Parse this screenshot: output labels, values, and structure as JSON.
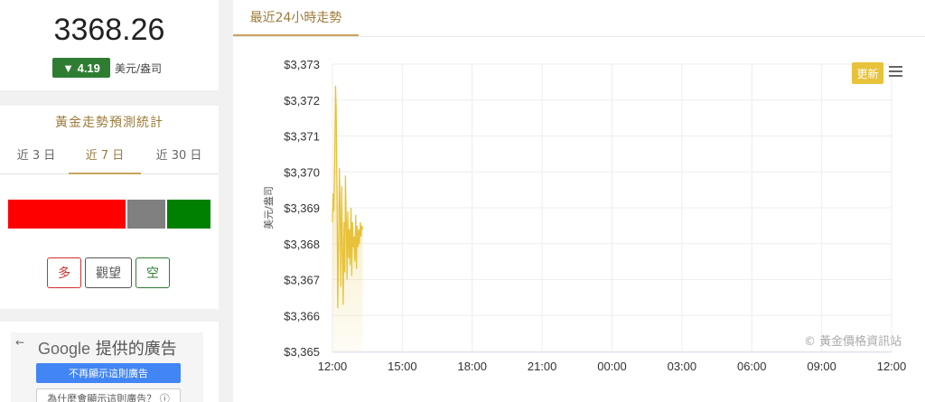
{
  "price_card": {
    "price": "3368.26",
    "change": "▼ 4.19",
    "unit": "美元/盎司"
  },
  "forecast": {
    "title": "黃金走勢預測統計",
    "tabs": [
      {
        "label": "近 3 日",
        "active": false
      },
      {
        "label": "近 7 日",
        "active": true
      },
      {
        "label": "近 30 日",
        "active": false
      }
    ],
    "bar": [
      {
        "name": "多",
        "fraction": 0.58,
        "color": "#ff0000"
      },
      {
        "name": "觀望",
        "fraction": 0.195,
        "color": "#808080"
      },
      {
        "name": "空",
        "fraction": 0.225,
        "color": "#008000"
      }
    ],
    "buttons": [
      {
        "label": "多",
        "color": "#d32f2f"
      },
      {
        "label": "觀望",
        "color": "#555555"
      },
      {
        "label": "空",
        "color": "#2e7d32"
      }
    ]
  },
  "ad": {
    "back_glyph": "←",
    "google": "Google",
    "provided": "提供的廣告",
    "stop_button": "不再顯示這則廣告",
    "why_button": "為什麼會顯示這則廣告？ ⓘ"
  },
  "chart": {
    "tab_label": "最近24小時走勢",
    "update_label": "更新",
    "credit": "© 黃金價格資訊站",
    "accent_color": "#e8c23a"
  },
  "chart_data": {
    "type": "area",
    "ylabel": "美元/盎司",
    "ylim": [
      3365,
      3373
    ],
    "yticks": [
      "$3,373",
      "$3,372",
      "$3,371",
      "$3,370",
      "$3,369",
      "$3,368",
      "$3,367",
      "$3,366",
      "$3,365"
    ],
    "xticks": [
      "12:00",
      "15:00",
      "18:00",
      "21:00",
      "00:00",
      "03:00",
      "06:00",
      "09:00",
      "12:00"
    ],
    "xlim_hours": [
      0,
      24
    ],
    "grid": true,
    "series": [
      {
        "x_hours": [
          0.0,
          0.03,
          0.06,
          0.1,
          0.13,
          0.16,
          0.2,
          0.23,
          0.26,
          0.3,
          0.33,
          0.36,
          0.4,
          0.43,
          0.46,
          0.5,
          0.53,
          0.56,
          0.6,
          0.63,
          0.66,
          0.7,
          0.73,
          0.76,
          0.8,
          0.83,
          0.86,
          0.9,
          0.93,
          0.96,
          1.0,
          1.03,
          1.06,
          1.1,
          1.13,
          1.16,
          1.2,
          1.23,
          1.26,
          1.3
        ],
        "values": [
          3368.6,
          3369.4,
          3368.9,
          3370.5,
          3372.4,
          3371.8,
          3369.2,
          3366.2,
          3367.8,
          3370.1,
          3369.0,
          3366.8,
          3369.6,
          3368.0,
          3366.3,
          3368.6,
          3367.2,
          3369.9,
          3368.3,
          3367.0,
          3368.9,
          3367.6,
          3368.4,
          3367.4,
          3369.0,
          3367.1,
          3368.6,
          3367.9,
          3368.2,
          3367.5,
          3368.8,
          3367.3,
          3368.5,
          3367.9,
          3368.4,
          3368.0,
          3368.6,
          3368.2,
          3368.5,
          3368.4
        ]
      }
    ]
  }
}
